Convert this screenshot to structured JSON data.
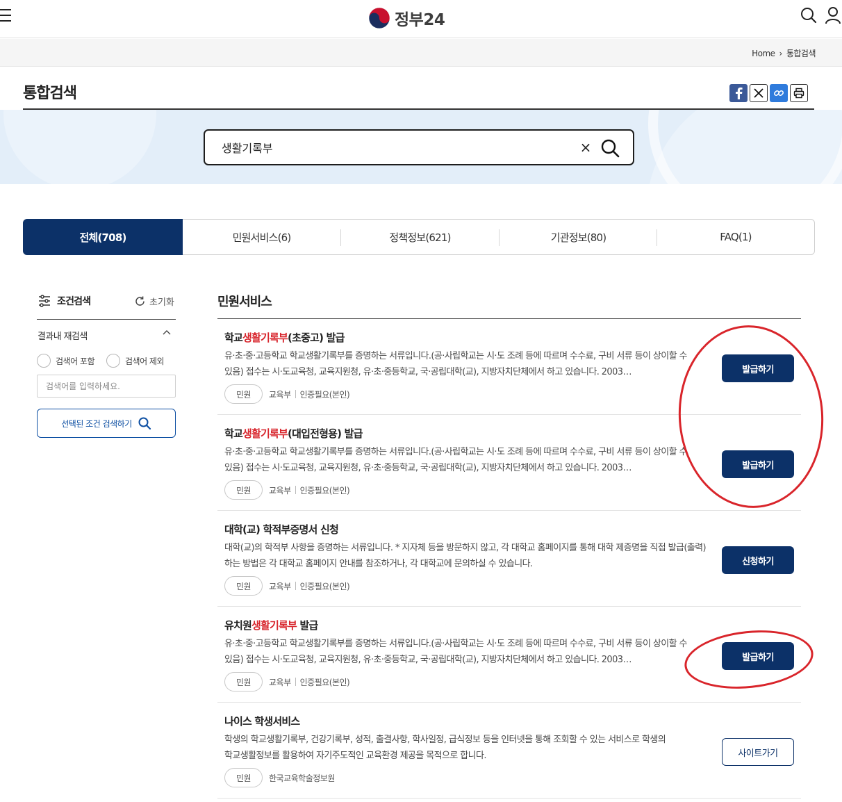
{
  "header": {
    "logo_text": "정부24",
    "menu_icon": "hamburger-menu-icon",
    "search_icon": "search-icon",
    "user_icon": "user-icon"
  },
  "breadcrumb": {
    "home": "Home",
    "current": "통합검색"
  },
  "page": {
    "title": "통합검색"
  },
  "share": {
    "icons": [
      "facebook-icon",
      "x-icon",
      "link-icon",
      "print-icon"
    ]
  },
  "search": {
    "query": "생활기록부",
    "clear_label": "×"
  },
  "tabs": [
    {
      "label": "전체(708)",
      "active": true
    },
    {
      "label": "민원서비스(6)",
      "active": false
    },
    {
      "label": "정책정보(621)",
      "active": false
    },
    {
      "label": "기관정보(80)",
      "active": false
    },
    {
      "label": "FAQ(1)",
      "active": false
    }
  ],
  "filter": {
    "title": "조건검색",
    "reset_label": "초기화",
    "refine_title": "결과내 재검색",
    "include_label": "검색어 포함",
    "exclude_label": "검색어 제외",
    "input_placeholder": "검색어를 입력하세요.",
    "submit_label": "선택된 조건 검색하기"
  },
  "results": {
    "section_title": "민원서비스",
    "items": [
      {
        "title_pre": "학교",
        "title_hl": "생활기록부",
        "title_post": "(초중고) 발급",
        "desc": "유·초·중·고등학교 학교생활기록부를 증명하는 서류입니다.(공·사립학교는 시·도 조례 등에 따르며 수수료, 구비 서류 등이 상이할 수 있음) 접수는 시·도교육청, 교육지원청, 유·초·중등학교, 국·공립대학(교), 지방자치단체에서 하고 있습니다. 2003…",
        "tag": "민원",
        "org": "교육부",
        "auth": "인증필요(본인)",
        "action": "발급하기"
      },
      {
        "title_pre": "학교",
        "title_hl": "생활기록부",
        "title_post": "(대입전형용) 발급",
        "desc": "유·초·중·고등학교 학교생활기록부를 증명하는 서류입니다.(공·사립학교는 시·도 조례 등에 따르며 수수료, 구비 서류 등이 상이할 수 있음) 접수는 시·도교육청, 교육지원청, 유·초·중등학교, 국·공립대학(교), 지방자치단체에서 하고 있습니다. 2003…",
        "tag": "민원",
        "org": "교육부",
        "auth": "인증필요(본인)",
        "action": "발급하기"
      },
      {
        "title_pre": "대학(교) 학적부증명서 신청",
        "title_hl": "",
        "title_post": "",
        "desc": "대학(교)의 학적부 사항을 증명하는 서류입니다. * 지자체 등을 방문하지 않고, 각 대학교 홈페이지를 통해 대학 제증명을 직접 발급(출력)하는 방법은 각 대학교 홈페이지 안내를 참조하거나, 각 대학교에 문의하실 수 있습니다.",
        "tag": "민원",
        "org": "교육부",
        "auth": "인증필요(본인)",
        "action": "신청하기"
      },
      {
        "title_pre": "유치원",
        "title_hl": "생활기록부",
        "title_post": " 발급",
        "desc": "유·초·중·고등학교 학교생활기록부를 증명하는 서류입니다.(공·사립학교는 시·도 조례 등에 따르며 수수료, 구비 서류 등이 상이할 수 있음) 접수는 시·도교육청, 교육지원청, 유·초·중등학교, 국·공립대학(교), 지방자치단체에서 하고 있습니다. 2003…",
        "tag": "민원",
        "org": "교육부",
        "auth": "인증필요(본인)",
        "action": "발급하기"
      },
      {
        "title_pre": "나이스 학생서비스",
        "title_hl": "",
        "title_post": "",
        "desc": "학생의 학교생활기록부, 건강기록부, 성적, 출결사항, 학사일정, 급식정보 등을 인터넷을 통해 조회할 수 있는 서비스로 학생의 학교생활정보를 활용하여 자기주도적인 교육환경 제공을 목적으로 합니다.",
        "tag": "민원",
        "org": "한국교육학술정보원",
        "auth": "",
        "action": "사이트가기"
      }
    ]
  },
  "colors": {
    "primary": "#0c3168",
    "highlight": "#d8262d",
    "band": "#e3eef9",
    "annotation": "#d9252b"
  }
}
